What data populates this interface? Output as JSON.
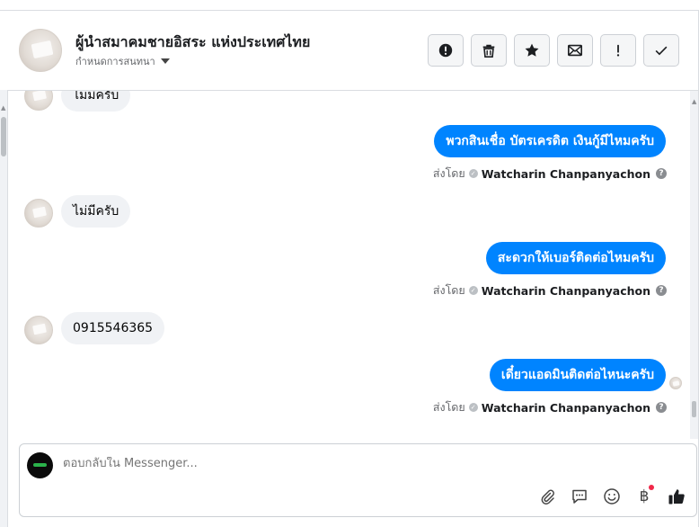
{
  "header": {
    "title": "ผู้นำสมาคมชายอิสระ แห่งประเทศไทย",
    "subtitle": "กำหนดการสนทนา",
    "tools": [
      {
        "icon": "alert-icon",
        "name": "mark-spam-button"
      },
      {
        "icon": "trash-icon",
        "name": "delete-button"
      },
      {
        "icon": "star-icon",
        "name": "star-button"
      },
      {
        "icon": "envelope-icon",
        "name": "mark-unread-button"
      },
      {
        "icon": "exclamation-icon",
        "name": "follow-up-button"
      },
      {
        "icon": "check-icon",
        "name": "mark-done-button"
      }
    ]
  },
  "messages": [
    {
      "direction": "in",
      "text": "ไม่มีครับ"
    },
    {
      "direction": "out",
      "text": "พวกสินเชื่อ บัตรเครดิต เงินกู้มีไหมครับ",
      "sent_by_label": "ส่งโดย",
      "sender": "Watcharin Chanpanyachon"
    },
    {
      "direction": "in",
      "text": "ไม่มีครับ"
    },
    {
      "direction": "out",
      "text": "สะดวกให้เบอร์ติดต่อไหมครับ",
      "sent_by_label": "ส่งโดย",
      "sender": "Watcharin Chanpanyachon"
    },
    {
      "direction": "in",
      "text": "0915546365"
    },
    {
      "direction": "out",
      "text": "เดี๋ยวแอดมินติดต่อไหนะครับ",
      "sent_by_label": "ส่งโดย",
      "sender": "Watcharin Chanpanyachon"
    }
  ],
  "composer": {
    "placeholder": "ตอบกลับใน Messenger...",
    "icons": [
      "paperclip-icon",
      "saved-reply-icon",
      "emoji-icon",
      "baht-payment-icon",
      "thumbs-up-icon"
    ],
    "baht_symbol": "฿"
  },
  "colors": {
    "outgoing_bubble": "#0084ff",
    "incoming_bubble": "#f0f2f5",
    "notification_dot": "#f02849"
  }
}
